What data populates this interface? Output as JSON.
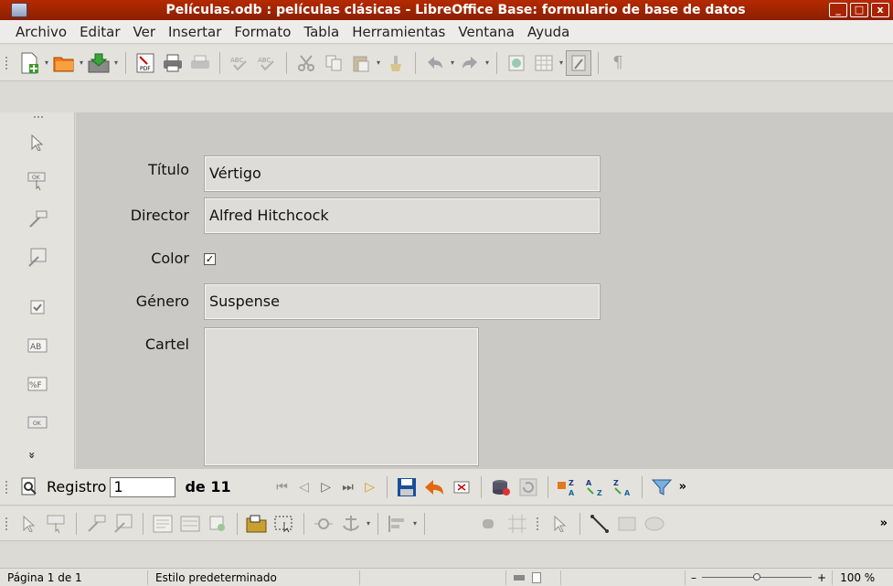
{
  "window": {
    "title": "Películas.odb : películas clásicas - LibreOffice Base: formulario de base de datos",
    "buttons": [
      "_",
      "□",
      "x"
    ]
  },
  "menu": [
    "Archivo",
    "Editar",
    "Ver",
    "Insertar",
    "Formato",
    "Tabla",
    "Herramientas",
    "Ventana",
    "Ayuda"
  ],
  "toolbar_icons": [
    "new-document-icon",
    "open-icon",
    "save-icon",
    "export-pdf-icon",
    "print-icon",
    "print-preview-icon",
    "spellcheck-icon",
    "autospellcheck-icon",
    "cut-icon",
    "copy-icon",
    "paste-icon",
    "clone-formatting-icon",
    "undo-icon",
    "redo-icon",
    "navigator-icon",
    "table-icon",
    "design-mode-icon",
    "formatting-marks-icon"
  ],
  "form": {
    "fields": [
      {
        "label": "Título",
        "value": "Vértigo"
      },
      {
        "label": "Director",
        "value": "Alfred Hitchcock"
      },
      {
        "label": "Color",
        "checked": true,
        "mark": "✓"
      },
      {
        "label": "Género",
        "value": "Suspense"
      },
      {
        "label": "Cartel",
        "value": ""
      }
    ]
  },
  "navigation": {
    "record_label": "Registro",
    "record_value": "1",
    "of_label": "de 11",
    "more": "»"
  },
  "formbar": {
    "more": "»"
  },
  "left_toolbar": {
    "more": "»"
  },
  "status": {
    "page": "Página 1 de 1",
    "style": "Estilo predeterminado",
    "zoom_minus": "–",
    "zoom_plus": "+",
    "zoom": "100 %",
    "zoom_level": 0.5
  },
  "colors": {
    "titlebar": "#9f2500",
    "canvas": "#cbc9c5",
    "toolbar": "#e4e2dd"
  }
}
